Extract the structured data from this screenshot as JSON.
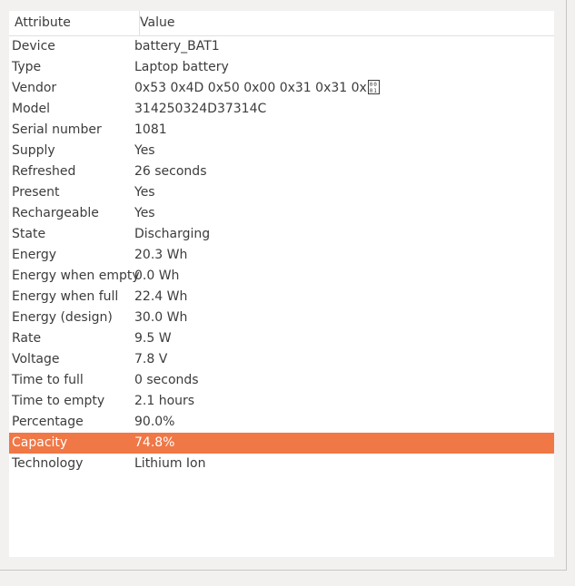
{
  "table": {
    "columns": {
      "attribute": "Attribute",
      "value": "Value"
    },
    "rows": [
      {
        "attribute": "Device",
        "value": "battery_BAT1"
      },
      {
        "attribute": "Type",
        "value": "Laptop battery"
      },
      {
        "attribute": "Vendor",
        "value": "0x53 0x4D 0x50 0x00 0x31 0x31 0x",
        "trailing_glyph": "0001"
      },
      {
        "attribute": "Model",
        "value": "314250324D37314C"
      },
      {
        "attribute": "Serial number",
        "value": "1081"
      },
      {
        "attribute": "Supply",
        "value": "Yes"
      },
      {
        "attribute": "Refreshed",
        "value": "26 seconds"
      },
      {
        "attribute": "Present",
        "value": "Yes"
      },
      {
        "attribute": "Rechargeable",
        "value": "Yes"
      },
      {
        "attribute": "State",
        "value": "Discharging"
      },
      {
        "attribute": "Energy",
        "value": "20.3 Wh"
      },
      {
        "attribute": "Energy when empty",
        "value": "0.0 Wh"
      },
      {
        "attribute": "Energy when full",
        "value": "22.4 Wh"
      },
      {
        "attribute": "Energy (design)",
        "value": "30.0 Wh"
      },
      {
        "attribute": "Rate",
        "value": "9.5 W"
      },
      {
        "attribute": "Voltage",
        "value": "7.8 V"
      },
      {
        "attribute": "Time to full",
        "value": "0 seconds"
      },
      {
        "attribute": "Time to empty",
        "value": "2.1 hours"
      },
      {
        "attribute": "Percentage",
        "value": "90.0%"
      },
      {
        "attribute": "Capacity",
        "value": "74.8%",
        "selected": true
      },
      {
        "attribute": "Technology",
        "value": "Lithium Ion"
      }
    ]
  },
  "colors": {
    "selection": "#f07746",
    "background": "#f2f1f0",
    "table_background": "#ffffff"
  }
}
